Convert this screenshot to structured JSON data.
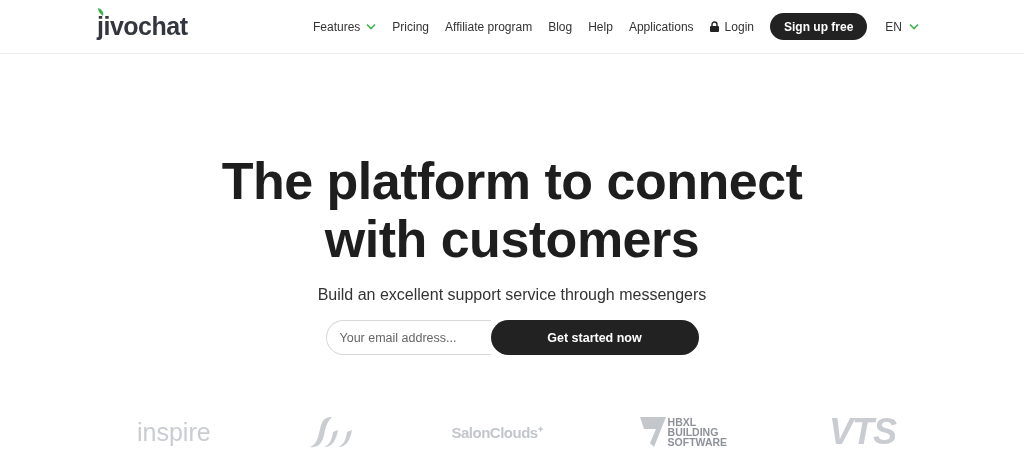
{
  "header": {
    "logo": "jivochat",
    "nav": [
      {
        "label": "Features",
        "kind": "dropdown"
      },
      {
        "label": "Pricing",
        "kind": "link"
      },
      {
        "label": "Affiliate program",
        "kind": "link"
      },
      {
        "label": "Blog",
        "kind": "link"
      },
      {
        "label": "Help",
        "kind": "link"
      },
      {
        "label": "Applications",
        "kind": "link"
      },
      {
        "label": "Login",
        "kind": "login"
      }
    ],
    "signup": "Sign up free",
    "language": "EN"
  },
  "hero": {
    "title": "The platform to connect with customers",
    "subtitle": "Build an excellent support service through messengers",
    "email": {
      "placeholder": "Your email address..."
    },
    "cta": "Get started now"
  },
  "clients": [
    {
      "kind": "light",
      "name": "inspire"
    },
    {
      "kind": "mark"
    },
    {
      "kind": "plain",
      "name": "SalonClouds⁺"
    },
    {
      "kind": "stacked",
      "name": "HBXL BUILDING SOFTWARE"
    },
    {
      "kind": "heavy",
      "name": "VTS"
    }
  ]
}
